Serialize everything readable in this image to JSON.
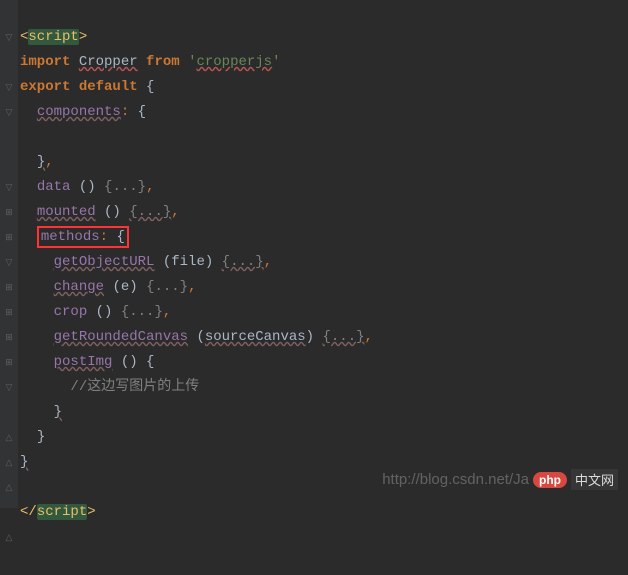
{
  "gutter": [
    "▽",
    "",
    "▽",
    "▽",
    "",
    "",
    "▽",
    "⊞",
    "⊞",
    "▽",
    "⊞",
    "⊞",
    "⊞",
    "⊞",
    "▽",
    "",
    "△",
    "△",
    "△",
    "",
    "△",
    ""
  ],
  "code": {
    "l1": {
      "open": "<",
      "tag": "script",
      "close": ">"
    },
    "l2": {
      "kw1": "import",
      "sp1": " ",
      "name": "Cropper",
      "sp2": " ",
      "kw2": "from",
      "sp3": " ",
      "q1": "'",
      "str": "cropperjs",
      "q2": "'"
    },
    "l3": {
      "kw1": "export",
      "sp1": " ",
      "kw2": "default",
      "sp2": " ",
      "brace": "{"
    },
    "l4": {
      "indent": "  ",
      "prop": "components",
      "colon": ":",
      "sp": " ",
      "brace": "{"
    },
    "l5": "",
    "l6": {
      "indent": "  ",
      "brace": "}",
      "comma": ","
    },
    "l7": {
      "indent": "  ",
      "prop": "data",
      "sp1": " ",
      "paren": "()",
      "sp2": " ",
      "collapsed": "{...}",
      "comma": ","
    },
    "l8": {
      "indent": "  ",
      "prop": "mounted",
      "sp1": " ",
      "paren": "()",
      "sp2": " ",
      "collapsed": "{...}",
      "comma": ","
    },
    "l9": {
      "indent": "  ",
      "prop": "methods",
      "sp": ": ",
      "brace": "{"
    },
    "l10": {
      "indent": "    ",
      "prop": "getObjectURL",
      "sp1": " ",
      "po": "(",
      "param": "file",
      "pc": ")",
      "sp2": " ",
      "collapsed": "{...}",
      "comma": ","
    },
    "l11": {
      "indent": "    ",
      "prop": "change",
      "sp1": " ",
      "po": "(",
      "param": "e",
      "pc": ")",
      "sp2": " ",
      "collapsed": "{...}",
      "comma": ","
    },
    "l12": {
      "indent": "    ",
      "prop": "crop",
      "sp1": " ",
      "paren": "()",
      "sp2": " ",
      "collapsed": "{...}",
      "comma": ","
    },
    "l13": {
      "indent": "    ",
      "prop": "getRoundedCanvas",
      "sp1": " ",
      "po": "(",
      "param": "sourceCanvas",
      "pc": ")",
      "sp2": " ",
      "collapsed": "{...}",
      "comma": ","
    },
    "l14": {
      "indent": "    ",
      "prop": "postImg",
      "sp1": " ",
      "paren": "()",
      "sp2": " ",
      "brace": "{"
    },
    "l15": {
      "indent": "      ",
      "comment": "//这边写图片的上传"
    },
    "l16": {
      "indent": "    ",
      "brace": "}"
    },
    "l17": {
      "indent": "  ",
      "brace": "}"
    },
    "l18": {
      "brace": "}"
    },
    "l19": "",
    "l20": {
      "open": "</",
      "tag": "script",
      "close": ">"
    }
  },
  "watermark": {
    "url": "http://blog.csdn.net/Ja",
    "badge": "php",
    "cn": "中文网"
  }
}
